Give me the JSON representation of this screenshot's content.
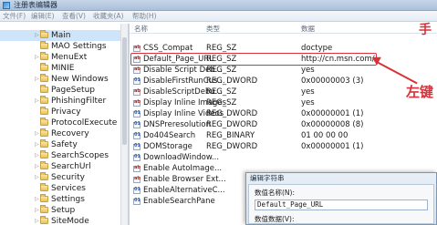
{
  "window": {
    "title": "注册表编辑器"
  },
  "menu": [
    {
      "label": "文件(F)"
    },
    {
      "label": "编辑(E)"
    },
    {
      "label": "查看(V)"
    },
    {
      "label": "收藏夹(A)"
    },
    {
      "label": "帮助(H)"
    }
  ],
  "tree": {
    "items": [
      {
        "label": "Main",
        "selected": true,
        "expandable": true
      },
      {
        "label": "MAO Settings",
        "expandable": false
      },
      {
        "label": "MenuExt",
        "expandable": true
      },
      {
        "label": "MINIE",
        "expandable": false
      },
      {
        "label": "New Windows",
        "expandable": true
      },
      {
        "label": "PageSetup",
        "expandable": false
      },
      {
        "label": "PhishingFilter",
        "expandable": true
      },
      {
        "label": "Privacy",
        "expandable": false
      },
      {
        "label": "ProtocolExecute",
        "expandable": false
      },
      {
        "label": "Recovery",
        "expandable": true
      },
      {
        "label": "Safety",
        "expandable": true
      },
      {
        "label": "SearchScopes",
        "expandable": true
      },
      {
        "label": "SearchUrl",
        "expandable": true
      },
      {
        "label": "Security",
        "expandable": true
      },
      {
        "label": "Services",
        "expandable": false
      },
      {
        "label": "Settings",
        "expandable": true
      },
      {
        "label": "Setup",
        "expandable": true
      },
      {
        "label": "SiteMode",
        "expandable": true
      }
    ]
  },
  "list": {
    "columns": {
      "name": "名称",
      "type": "类型",
      "data": "数据"
    },
    "rows": [
      {
        "name": "CSS_Compat",
        "type": "REG_SZ",
        "data": "doctype",
        "icon": "string-value-icon"
      },
      {
        "name": "Default_Page_URL",
        "type": "REG_SZ",
        "data": "http://cn.msn.com/",
        "icon": "string-value-icon"
      },
      {
        "name": "Disable Script Deb...",
        "type": "REG_SZ",
        "data": "yes",
        "icon": "string-value-icon"
      },
      {
        "name": "DisableFirstRunCus...",
        "type": "REG_DWORD",
        "data": "0x00000003 (3)",
        "icon": "binary-value-icon"
      },
      {
        "name": "DisableScriptDebu...",
        "type": "REG_SZ",
        "data": "yes",
        "icon": "string-value-icon"
      },
      {
        "name": "Display Inline Images",
        "type": "REG_SZ",
        "data": "yes",
        "icon": "string-value-icon"
      },
      {
        "name": "Display Inline Videos",
        "type": "REG_DWORD",
        "data": "0x00000001 (1)",
        "icon": "binary-value-icon"
      },
      {
        "name": "DNSPreresolution",
        "type": "REG_DWORD",
        "data": "0x00000008 (8)",
        "icon": "binary-value-icon"
      },
      {
        "name": "Do404Search",
        "type": "REG_BINARY",
        "data": "01 00 00 00",
        "icon": "binary-value-icon"
      },
      {
        "name": "DOMStorage",
        "type": "REG_DWORD",
        "data": "0x00000001 (1)",
        "icon": "binary-value-icon"
      },
      {
        "name": "DownloadWindow...",
        "type": "",
        "data": "",
        "icon": "binary-value-icon"
      },
      {
        "name": "Enable AutoImage...",
        "type": "",
        "data": "",
        "icon": "string-value-icon"
      },
      {
        "name": "Enable Browser Ext...",
        "type": "",
        "data": "",
        "icon": "string-value-icon"
      },
      {
        "name": "EnableAlternativeC...",
        "type": "",
        "data": "",
        "icon": "binary-value-icon"
      },
      {
        "name": "EnableSearchPane",
        "type": "",
        "data": "",
        "icon": "binary-value-icon"
      }
    ]
  },
  "annotations": {
    "top": "手",
    "middle": "左键"
  },
  "dialog": {
    "title": "编辑字符串",
    "name_label": "数值名称(N):",
    "name_value": "Default_Page_URL",
    "data_label": "数值数据(V):"
  },
  "colors": {
    "annotation": "#d8323b",
    "selection": "#cde4fb"
  }
}
